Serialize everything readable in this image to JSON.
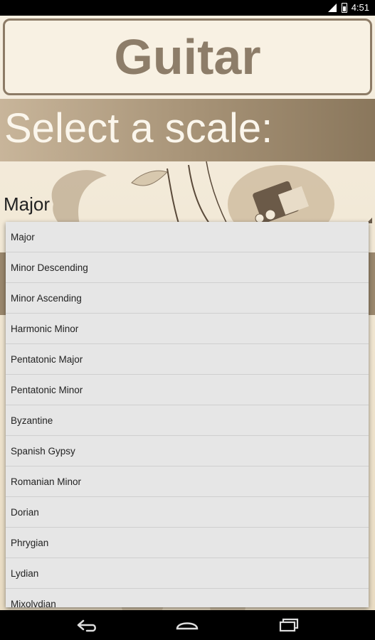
{
  "status": {
    "time": "4:51"
  },
  "app": {
    "title": "Guitar",
    "header": "Select a scale:",
    "selected_scale": "Major"
  },
  "dropdown": {
    "items": [
      "Major",
      "Minor Descending",
      "Minor Ascending",
      "Harmonic Minor",
      "Pentatonic Major",
      "Pentatonic Minor",
      "Byzantine",
      "Spanish Gypsy",
      "Romanian Minor",
      "Dorian",
      "Phrygian",
      "Lydian",
      "Mixolydian"
    ]
  },
  "icons": {
    "signal": "signal-icon",
    "battery": "battery-icon",
    "back": "back-icon",
    "home": "home-icon",
    "recents": "recents-icon"
  },
  "colors": {
    "title_text": "#8d7d69",
    "header_band": "#a89478",
    "list_bg": "#e6e6e6"
  }
}
